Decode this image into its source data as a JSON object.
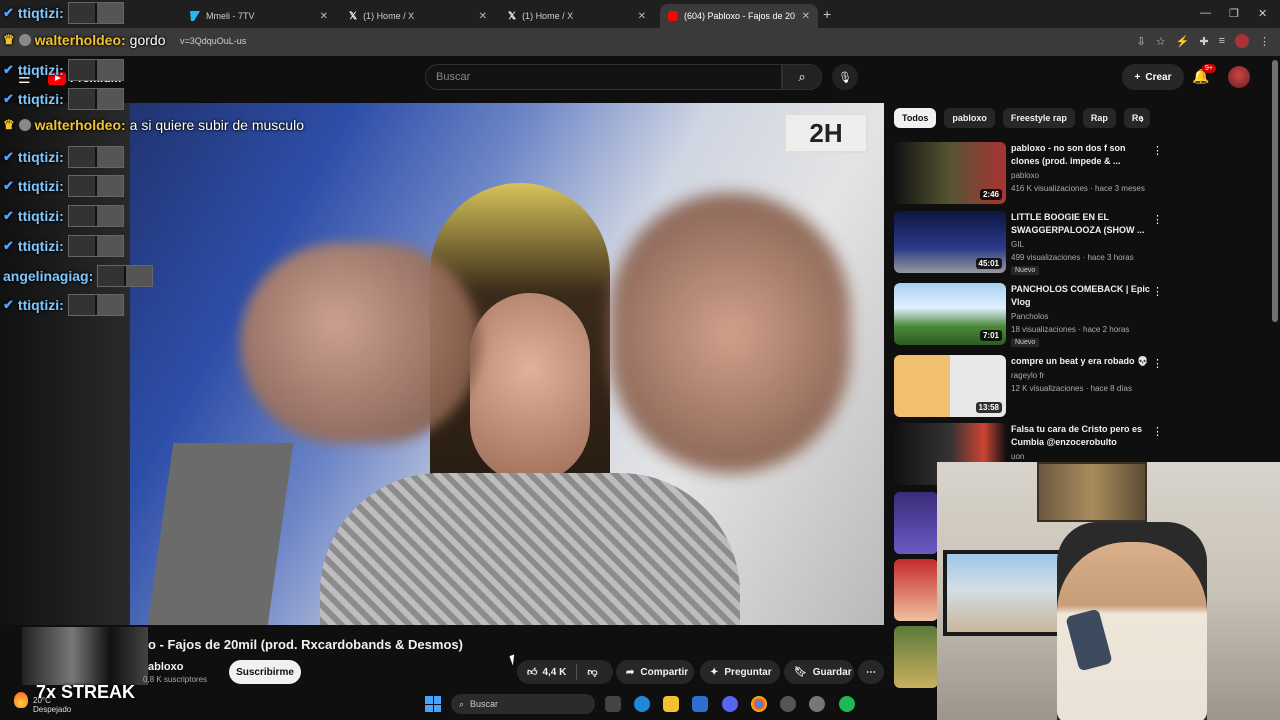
{
  "browser": {
    "tabs": [
      {
        "label": "Mmeli - 7TV",
        "favicon": "7tv-icon",
        "active": false
      },
      {
        "label": "(1) Home / X",
        "favicon": "x-icon",
        "active": false
      },
      {
        "label": "(1) Home / X",
        "favicon": "x-icon",
        "active": false
      },
      {
        "label": "(604) Pabloxo - Fajos de 20",
        "favicon": "youtube-icon",
        "active": true
      }
    ],
    "url": "v=3QdquOuL-us"
  },
  "youtube": {
    "logo_text": "Premium",
    "search_placeholder": "Buscar",
    "create_label": "Crear",
    "notif_badge": "9+"
  },
  "chat": [
    {
      "user": "ttiqtizi:",
      "badge": "verified",
      "msg": "",
      "emote": true
    },
    {
      "user": "walterholdeo:",
      "badge": "crown",
      "msg": "gordo",
      "emote": false
    },
    {
      "user": "ttiqtizi:",
      "badge": "verified",
      "msg": "",
      "emote": true
    },
    {
      "user": "ttiqtizi:",
      "badge": "verified",
      "msg": "",
      "emote": true
    },
    {
      "user": "walterholdeo:",
      "badge": "crown",
      "msg": "a si quiere subir de musculo",
      "emote": false
    },
    {
      "user": "ttiqtizi:",
      "badge": "verified",
      "msg": "",
      "emote": true
    },
    {
      "user": "ttiqtizi:",
      "badge": "verified",
      "msg": "",
      "emote": true
    },
    {
      "user": "ttiqtizi:",
      "badge": "verified",
      "msg": "",
      "emote": true
    },
    {
      "user": "ttiqtizi:",
      "badge": "verified",
      "msg": "",
      "emote": true
    },
    {
      "user": "angelinagiag:",
      "badge": "none",
      "msg": "",
      "emote": true
    },
    {
      "user": "ttiqtizi:",
      "badge": "verified",
      "msg": "",
      "emote": true
    }
  ],
  "video": {
    "title": "o - Fajos de 20mil (prod. Rxcardobands & Desmos)",
    "channel": "abloxo",
    "subscribers": "0,8 K suscriptores",
    "subscribe_label": "Suscribirme",
    "likes": "4,4 K",
    "share_label": "Compartir",
    "ask_label": "Preguntar",
    "save_label": "Guardar",
    "corner_logo": "2H"
  },
  "chips": [
    "Todos",
    "pabloxo",
    "Freestyle rap",
    "Rap",
    "Re"
  ],
  "recommendations": [
    {
      "title": "pabloxo - no son dos f son clones (prod. impede & ...",
      "channel": "pabloxo",
      "meta": "416 K visualizaciones · hace 3 meses",
      "duration": "2:46",
      "badge": ""
    },
    {
      "title": "LITTLE BOOGIE EN EL SWAGGERPALOOZA (SHOW ...",
      "channel": "GIL",
      "meta": "499 visualizaciones · hace 3 horas",
      "duration": "45:01",
      "badge": "Nuevo"
    },
    {
      "title": "PANCHOLOS COMEBACK | Epic Vlog",
      "channel": "Pancholos",
      "meta": "18 visualizaciones · hace 2 horas",
      "duration": "7:01",
      "badge": "Nuevo"
    },
    {
      "title": "compre un beat y era robado 💀",
      "channel": "rageylo fr",
      "meta": "12 K visualizaciones · hace 8 días",
      "duration": "13:58",
      "badge": ""
    },
    {
      "title": "Falsa tu cara de Cristo pero es Cumbia @enzocerobulto",
      "channel": "uon",
      "meta": "",
      "duration": "",
      "badge": ""
    }
  ],
  "overlay": {
    "streak": "7x STREAK",
    "weather_temp": "20°C",
    "weather_desc": "Despejado",
    "taskbar_search": "Buscar"
  }
}
